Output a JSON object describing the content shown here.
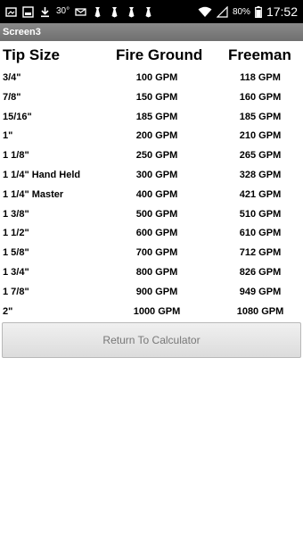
{
  "status_bar": {
    "temperature": "30°",
    "battery": "80%",
    "time": "17:52",
    "icons": [
      "gallery-icon",
      "image-icon",
      "download-icon",
      "mail-icon",
      "tie-icon",
      "tie-icon",
      "tie-icon",
      "tie-icon",
      "wifi-icon",
      "signal-icon",
      "battery-icon"
    ]
  },
  "titlebar": {
    "title": "Screen3"
  },
  "table": {
    "headers": [
      "Tip Size",
      "Fire Ground",
      "Freeman"
    ],
    "rows": [
      [
        "3/4\"",
        "100 GPM",
        "118 GPM"
      ],
      [
        "7/8\"",
        "150 GPM",
        "160 GPM"
      ],
      [
        "15/16\"",
        "185 GPM",
        "185 GPM"
      ],
      [
        "1\"",
        "200 GPM",
        "210 GPM"
      ],
      [
        "1 1/8\"",
        "250 GPM",
        "265 GPM"
      ],
      [
        "1 1/4\" Hand Held",
        "300 GPM",
        "328 GPM"
      ],
      [
        "1 1/4\" Master",
        "400 GPM",
        "421 GPM"
      ],
      [
        "1 3/8\"",
        "500 GPM",
        "510 GPM"
      ],
      [
        "1 1/2\"",
        "600 GPM",
        "610 GPM"
      ],
      [
        "1 5/8\"",
        "700 GPM",
        "712 GPM"
      ],
      [
        "1 3/4\"",
        "800 GPM",
        "826 GPM"
      ],
      [
        "1 7/8\"",
        "900 GPM",
        "949 GPM"
      ],
      [
        "2\"",
        "1000 GPM",
        "1080 GPM"
      ]
    ]
  },
  "button": {
    "label": "Return To Calculator"
  }
}
